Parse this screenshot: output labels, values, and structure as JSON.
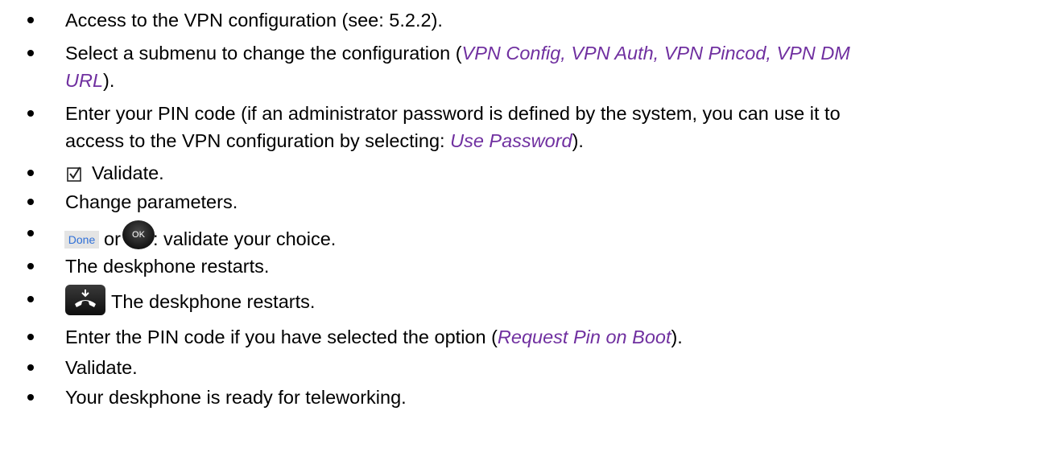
{
  "items": [
    {
      "text": "Access to the VPN configuration (see: 5.2.2)."
    },
    {
      "pre": "Select a submenu to change the configuration (",
      "em": "VPN Config, VPN Auth, VPN Pincod, VPN DM",
      "em2": "URL",
      "post": ")."
    },
    {
      "line1": "Enter your PIN code (if an administrator password is defined by the system, you can use it to",
      "line2_pre": "access to the VPN configuration by selecting: ",
      "em": "Use Password",
      "post": ")."
    },
    {
      "icon": "checkbox-icon",
      "text": "Validate."
    },
    {
      "text": "Change parameters."
    },
    {
      "done_label": "Done",
      "or": "or",
      "ok_label": "OK",
      "text": ": validate your choice."
    },
    {
      "text": "The deskphone restarts."
    },
    {
      "icon": "hang-up-key-icon",
      "text": "The deskphone restarts."
    },
    {
      "pre": "Enter the PIN code if you have selected the option (",
      "em": "Request Pin on Boot",
      "post": ")."
    },
    {
      "text": "Validate."
    },
    {
      "text": "Your deskphone is ready for teleworking."
    }
  ]
}
